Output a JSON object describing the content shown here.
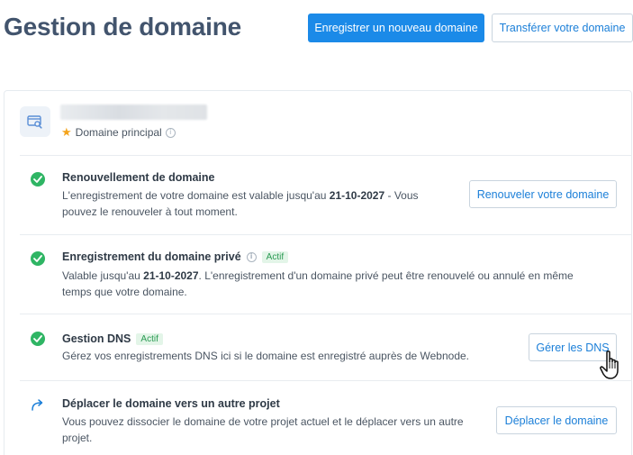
{
  "header": {
    "title": "Gestion de domaine",
    "register_button": "Enregistrer un nouveau domaine",
    "transfer_button": "Transférer votre domaine"
  },
  "domain": {
    "main_label": "Domaine principal",
    "icon": "domain-search-icon"
  },
  "sections": {
    "renewal": {
      "title": "Renouvellement de domaine",
      "desc_before": "L'enregistrement de votre domaine est valable jusqu'au ",
      "date": "21-10-2027",
      "desc_after": " - Vous pouvez le renouveler à tout moment.",
      "button": "Renouveler votre domaine",
      "status_icon": "check-circle-icon"
    },
    "private": {
      "title": "Enregistrement du domaine privé",
      "badge": "Actif",
      "desc_before": "Valable jusqu'au ",
      "date": "21-10-2027",
      "desc_after": ". L'enregistrement d'un domaine privé peut être renouvelé ou annulé en même temps que votre domaine.",
      "status_icon": "check-circle-icon"
    },
    "dns": {
      "title": "Gestion DNS",
      "badge": "Actif",
      "desc": "Gérez vos enregistrements DNS ici si le domaine est enregistré auprès de Webnode.",
      "button": "Gérer les DNS",
      "status_icon": "check-circle-icon"
    },
    "move": {
      "title": "Déplacer le domaine vers un autre projet",
      "desc": "Vous pouvez dissocier le domaine de votre projet actuel et le déplacer vers un autre projet.",
      "button": "Déplacer le domaine",
      "icon": "arrow-redirect-icon"
    }
  },
  "colors": {
    "primary": "#1b8ae8",
    "success": "#2fb564",
    "star": "#f4a41d"
  }
}
